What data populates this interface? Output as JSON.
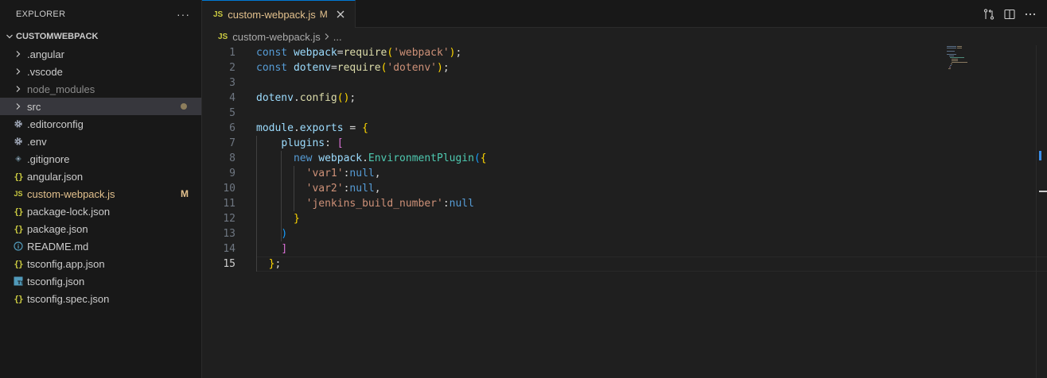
{
  "sidebar": {
    "title": "EXPLORER",
    "more": "···",
    "root_folder": "CUSTOMWEBPACK",
    "items": [
      {
        "name": ".angular",
        "kind": "folder",
        "icon": "chevron-right-icon"
      },
      {
        "name": ".vscode",
        "kind": "folder",
        "icon": "chevron-right-icon"
      },
      {
        "name": "node_modules",
        "kind": "folder",
        "icon": "chevron-right-icon",
        "dim": true
      },
      {
        "name": "src",
        "kind": "folder",
        "icon": "chevron-right-icon",
        "selected": true,
        "dot": true
      },
      {
        "name": ".editorconfig",
        "kind": "file",
        "icon": "gear-icon"
      },
      {
        "name": ".env",
        "kind": "file",
        "icon": "gear-icon"
      },
      {
        "name": ".gitignore",
        "kind": "file",
        "icon": "git-diamond-icon"
      },
      {
        "name": "angular.json",
        "kind": "file",
        "icon": "json-braces-icon"
      },
      {
        "name": "custom-webpack.js",
        "kind": "file",
        "icon": "js-icon",
        "badge": "M",
        "modified": true
      },
      {
        "name": "package-lock.json",
        "kind": "file",
        "icon": "json-braces-icon"
      },
      {
        "name": "package.json",
        "kind": "file",
        "icon": "json-braces-icon"
      },
      {
        "name": "README.md",
        "kind": "file",
        "icon": "info-icon"
      },
      {
        "name": "tsconfig.app.json",
        "kind": "file",
        "icon": "json-braces-icon"
      },
      {
        "name": "tsconfig.json",
        "kind": "file",
        "icon": "ts-icon"
      },
      {
        "name": "tsconfig.spec.json",
        "kind": "file",
        "icon": "json-braces-icon"
      }
    ]
  },
  "tab": {
    "icon_text": "JS",
    "label": "custom-webpack.js",
    "modified": "M"
  },
  "breadcrumb": {
    "icon_text": "JS",
    "file": "custom-webpack.js",
    "more": "..."
  },
  "colors": {
    "accent": "#0078d4",
    "js_yellow": "#cbcb41",
    "modified": "#e2c08d",
    "json_yellow": "#cbcb41",
    "info_blue": "#519aba",
    "ts_blue": "#519aba",
    "keyword": "#569cd6",
    "variable": "#9cdcfe",
    "function": "#dcdcaa",
    "string": "#ce9178",
    "class": "#4ec9b0",
    "bracket1": "#ffd700",
    "bracket2": "#da70d6",
    "bracket3": "#179fff",
    "plain": "#d4d4d4",
    "control": "#c586c0"
  },
  "code": {
    "active_line": 15,
    "lines": [
      {
        "n": "1",
        "tokens": [
          [
            "const ",
            "keyword"
          ],
          [
            "webpack",
            "variable"
          ],
          [
            "=",
            "plain"
          ],
          [
            "require",
            "function"
          ],
          [
            "(",
            "bracket1"
          ],
          [
            "'webpack'",
            "string"
          ],
          [
            ")",
            "bracket1"
          ],
          [
            ";",
            "plain"
          ]
        ]
      },
      {
        "n": "2",
        "tokens": [
          [
            "const ",
            "keyword"
          ],
          [
            "dotenv",
            "variable"
          ],
          [
            "=",
            "plain"
          ],
          [
            "require",
            "function"
          ],
          [
            "(",
            "bracket1"
          ],
          [
            "'dotenv'",
            "string"
          ],
          [
            ")",
            "bracket1"
          ],
          [
            ";",
            "plain"
          ]
        ]
      },
      {
        "n": "3",
        "tokens": []
      },
      {
        "n": "4",
        "tokens": [
          [
            "dotenv",
            "variable"
          ],
          [
            ".",
            "plain"
          ],
          [
            "config",
            "function"
          ],
          [
            "()",
            "bracket1"
          ],
          [
            ";",
            "plain"
          ]
        ]
      },
      {
        "n": "5",
        "tokens": []
      },
      {
        "n": "6",
        "tokens": [
          [
            "module",
            "variable"
          ],
          [
            ".",
            "plain"
          ],
          [
            "exports",
            "variable"
          ],
          [
            " = ",
            "plain"
          ],
          [
            "{",
            "bracket1"
          ]
        ]
      },
      {
        "n": "7",
        "tokens": [
          [
            "    ",
            "plain"
          ],
          [
            "plugins",
            "variable"
          ],
          [
            ": ",
            "plain"
          ],
          [
            "[",
            "bracket2"
          ]
        ]
      },
      {
        "n": "8",
        "tokens": [
          [
            "      ",
            "plain"
          ],
          [
            "new ",
            "keyword"
          ],
          [
            "webpack",
            "variable"
          ],
          [
            ".",
            "plain"
          ],
          [
            "EnvironmentPlugin",
            "class"
          ],
          [
            "(",
            "bracket3"
          ],
          [
            "{",
            "bracket1"
          ]
        ]
      },
      {
        "n": "9",
        "tokens": [
          [
            "        ",
            "plain"
          ],
          [
            "'var1'",
            "string"
          ],
          [
            ":",
            "plain"
          ],
          [
            "null",
            "keyword"
          ],
          [
            ",",
            "plain"
          ]
        ]
      },
      {
        "n": "10",
        "tokens": [
          [
            "        ",
            "plain"
          ],
          [
            "'var2'",
            "string"
          ],
          [
            ":",
            "plain"
          ],
          [
            "null",
            "keyword"
          ],
          [
            ",",
            "plain"
          ]
        ]
      },
      {
        "n": "11",
        "tokens": [
          [
            "        ",
            "plain"
          ],
          [
            "'jenkins_build_number'",
            "string"
          ],
          [
            ":",
            "plain"
          ],
          [
            "null",
            "keyword"
          ]
        ]
      },
      {
        "n": "12",
        "tokens": [
          [
            "      ",
            "plain"
          ],
          [
            "}",
            "bracket1"
          ]
        ]
      },
      {
        "n": "13",
        "tokens": [
          [
            "    ",
            "plain"
          ],
          [
            ")",
            "bracket3"
          ]
        ]
      },
      {
        "n": "14",
        "tokens": [
          [
            "    ",
            "plain"
          ],
          [
            "]",
            "bracket2"
          ]
        ]
      },
      {
        "n": "15",
        "tokens": [
          [
            "  ",
            "plain"
          ],
          [
            "}",
            "bracket1"
          ],
          [
            ";",
            "plain"
          ]
        ]
      }
    ]
  }
}
